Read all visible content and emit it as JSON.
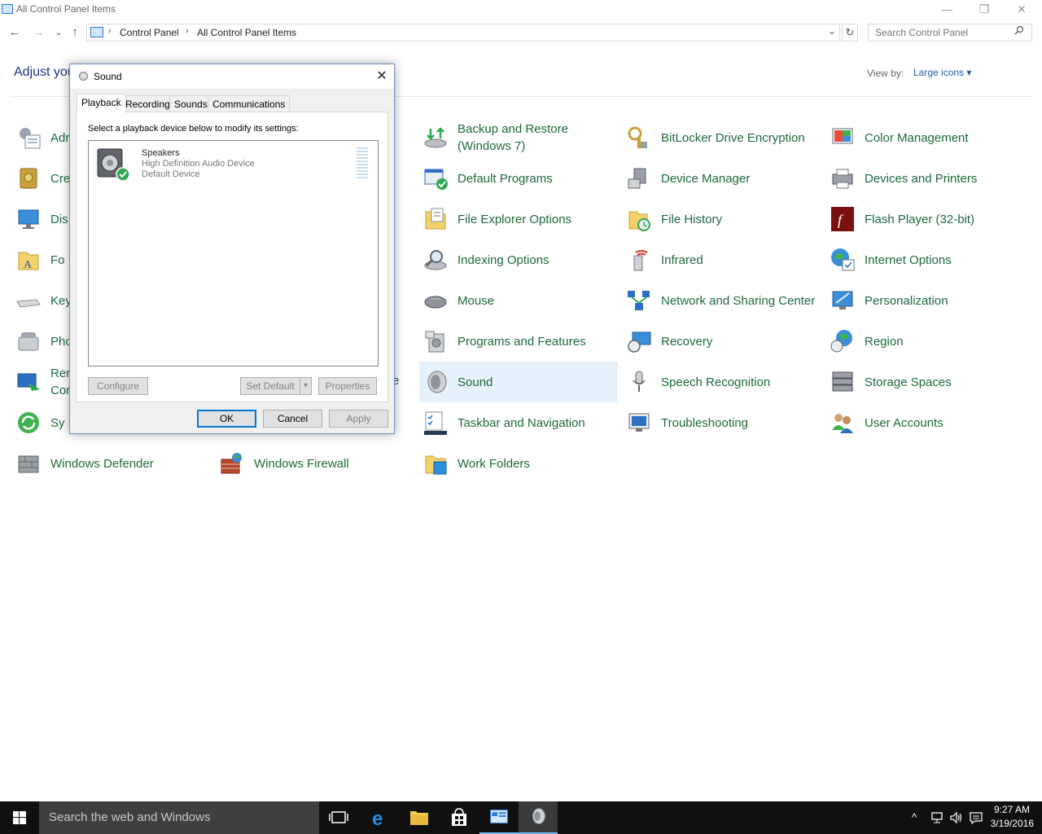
{
  "window": {
    "title": "All Control Panel Items",
    "minimize": "—",
    "restore": "❐",
    "close": "✕"
  },
  "nav": {
    "back": "←",
    "forward": "→",
    "recent": "⌄",
    "up": "↑",
    "breadcrumb": [
      "Control Panel",
      "All Control Panel Items"
    ],
    "separator": "›",
    "dropdown": "⌄",
    "refresh": "↻",
    "search_placeholder": "Search Control Panel"
  },
  "header": {
    "adjust_text": "Adjust you",
    "view_by_label": "View by:",
    "view_by_value": "Large icons ▾"
  },
  "items_col1": [
    {
      "label": "Adr"
    },
    {
      "label": "Cre"
    },
    {
      "label": "Dis"
    },
    {
      "label": "Fo"
    },
    {
      "label": "Key"
    },
    {
      "label": "Pho"
    },
    {
      "label": "Rer\nCor"
    },
    {
      "label": "Sy"
    },
    {
      "label": "Windows Defender"
    }
  ],
  "items_col2": [
    {
      "label": "Windows Firewall"
    }
  ],
  "items_col3": [
    {
      "label": "Backup and Restore (Windows 7)"
    },
    {
      "label": "Default Programs"
    },
    {
      "label": "File Explorer Options"
    },
    {
      "label": "Indexing Options"
    },
    {
      "label": "Mouse"
    },
    {
      "label": "Programs and Features"
    },
    {
      "label": "Sound"
    },
    {
      "label": "Taskbar and Navigation"
    },
    {
      "label": "Work Folders"
    }
  ],
  "items_col4": [
    {
      "label": "BitLocker Drive Encryption"
    },
    {
      "label": "Device Manager"
    },
    {
      "label": "File History"
    },
    {
      "label": "Infrared"
    },
    {
      "label": "Network and Sharing Center"
    },
    {
      "label": "Recovery"
    },
    {
      "label": "Speech Recognition"
    },
    {
      "label": "Troubleshooting"
    }
  ],
  "items_col5": [
    {
      "label": "Color Management"
    },
    {
      "label": "Devices and Printers"
    },
    {
      "label": "Flash Player (32-bit)"
    },
    {
      "label": "Internet Options"
    },
    {
      "label": "Personalization"
    },
    {
      "label": "Region"
    },
    {
      "label": "Storage Spaces"
    },
    {
      "label": "User Accounts"
    }
  ],
  "partial_text": "e",
  "dialog": {
    "title": "Sound",
    "close": "✕",
    "tabs": [
      "Playback",
      "Recording",
      "Sounds",
      "Communications"
    ],
    "instruction": "Select a playback device below to modify its settings:",
    "device": {
      "name": "Speakers",
      "description": "High Definition Audio Device",
      "status": "Default Device"
    },
    "buttons": {
      "configure": "Configure",
      "set_default": "Set Default",
      "set_default_arrow": "▾",
      "properties": "Properties",
      "ok": "OK",
      "cancel": "Cancel",
      "apply": "Apply"
    }
  },
  "taskbar": {
    "search_placeholder": "Search the web and Windows",
    "time": "9:27 AM",
    "date": "3/19/2016",
    "tray_chevron": "^"
  },
  "colors": {
    "link_green": "#1d6a38",
    "selection": "#e5f1fb",
    "taskbar": "#101010",
    "accent": "#0078d7"
  }
}
